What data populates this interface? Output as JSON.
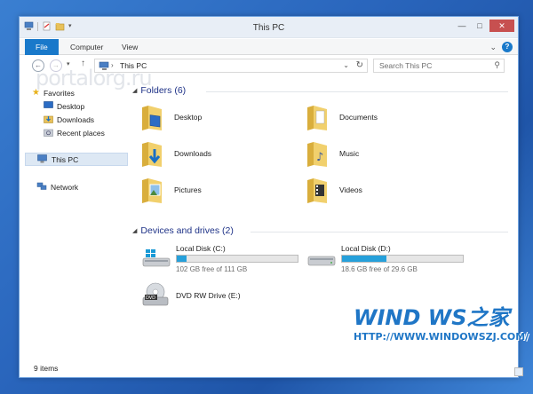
{
  "window": {
    "title": "This PC"
  },
  "ribbon": {
    "tabs": [
      {
        "label": "File"
      },
      {
        "label": "Computer"
      },
      {
        "label": "View"
      }
    ]
  },
  "address": {
    "path": "This PC",
    "search_placeholder": "Search This PC"
  },
  "nav": {
    "favorites": "Favorites",
    "items": [
      {
        "label": "Desktop"
      },
      {
        "label": "Downloads"
      },
      {
        "label": "Recent places"
      }
    ],
    "this_pc": "This PC",
    "network": "Network"
  },
  "folders": {
    "header": "Folders (6)",
    "items": [
      {
        "label": "Desktop"
      },
      {
        "label": "Documents"
      },
      {
        "label": "Downloads"
      },
      {
        "label": "Music"
      },
      {
        "label": "Pictures"
      },
      {
        "label": "Videos"
      }
    ]
  },
  "drives": {
    "header": "Devices and drives (2)",
    "items": [
      {
        "label": "Local Disk (C:)",
        "free": "102 GB free of 111 GB",
        "used_fraction": 0.08
      },
      {
        "label": "Local Disk (D:)",
        "free": "18.6 GB free of 29.6 GB",
        "used_fraction": 0.37
      },
      {
        "label": "DVD RW Drive (E:)"
      }
    ]
  },
  "status": {
    "item_count": "9 items"
  },
  "watermarks": {
    "portal": "portalorg.ru",
    "windows": "WIND WS之家",
    "url": "HTTP://WWW.WINDOWSZJ.COM/"
  },
  "colors": {
    "accent": "#1979ca",
    "drive_bar": "#26a0da",
    "header_text": "#1e3287"
  }
}
